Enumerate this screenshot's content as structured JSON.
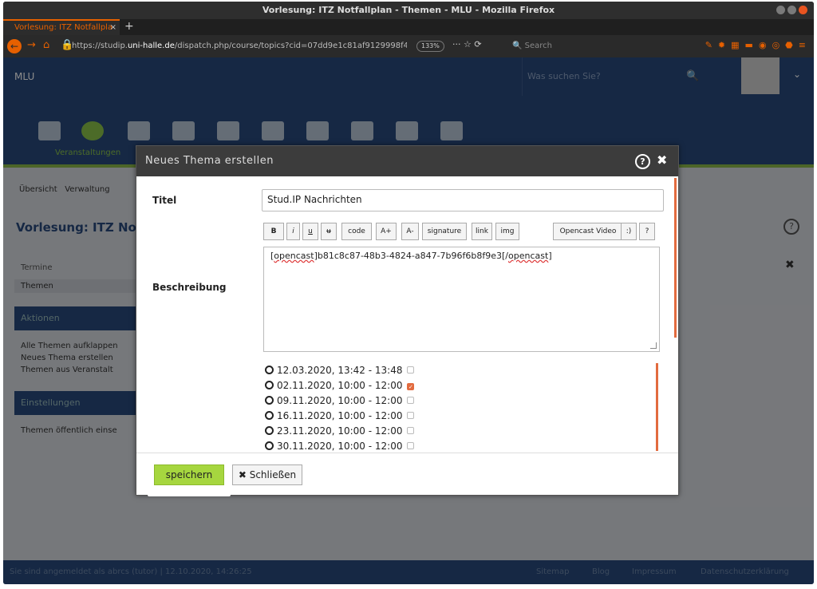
{
  "window": {
    "title": "Vorlesung: ITZ Notfallplan - Themen - MLU - Mozilla Firefox"
  },
  "tab": {
    "label": "Vorlesung: ITZ Notfallpla",
    "close": "×",
    "new": "+"
  },
  "url": {
    "prefix": "https://studip.",
    "domain": "uni-halle.de",
    "rest": "/dispatch.php/course/topics?cid=07dd9e1c81af9129998f4",
    "zoom": "133%",
    "search_placeholder": "Search"
  },
  "site": {
    "brand": "MLU",
    "search_placeholder": "Was suchen Sie?",
    "nav_active_label": "Veranstaltungen"
  },
  "breadcrumb": {
    "overview": "Übersicht",
    "admin": "Verwaltung"
  },
  "course_title": "Vorlesung: ITZ Not",
  "sidebar": {
    "termine": "Termine",
    "themen": "Themen",
    "aktionen": "Aktionen",
    "a1": "Alle Themen aufklappen",
    "a2": "Neues Thema erstellen",
    "a3": "Themen aus Veranstalt",
    "einstellungen": "Einstellungen",
    "e1": "Themen öffentlich einse"
  },
  "footer": {
    "login": "Sie sind angemeldet als abrcs (tutor) | 12.10.2020, 14:26:25",
    "sitemap": "Sitemap",
    "blog": "Blog",
    "impressum": "Impressum",
    "datenschutz": "Datenschutzerklärung"
  },
  "dialog": {
    "title": "Neues Thema erstellen",
    "help": "?",
    "close": "✖",
    "titel_label": "Titel",
    "titel_value": "Stud.IP Nachrichten",
    "beschreibung_label": "Beschreibung",
    "toolbar": [
      "B",
      "i",
      "u",
      "u",
      "code",
      "A+",
      "A-",
      "signature",
      "link",
      "img"
    ],
    "toolbar2": [
      "Opencast Video",
      ":)",
      "?"
    ],
    "desc_pre": "[",
    "desc_tag1": "opencast",
    "desc_mid": "]b81c8c87-48b3-4824-a847-7b96f6b8f9e3[/",
    "desc_tag2": "opencast",
    "desc_post": "]",
    "dates": [
      {
        "text": "12.03.2020, 13:42 - 13:48",
        "checked": false
      },
      {
        "text": "02.11.2020, 10:00 - 12:00",
        "checked": true
      },
      {
        "text": "09.11.2020, 10:00 - 12:00",
        "checked": false
      },
      {
        "text": "16.11.2020, 10:00 - 12:00",
        "checked": false
      },
      {
        "text": "23.11.2020, 10:00 - 12:00",
        "checked": false
      },
      {
        "text": "30.11.2020, 10:00 - 12:00",
        "checked": false
      }
    ],
    "save": "speichern",
    "schliessen": "Schließen"
  }
}
